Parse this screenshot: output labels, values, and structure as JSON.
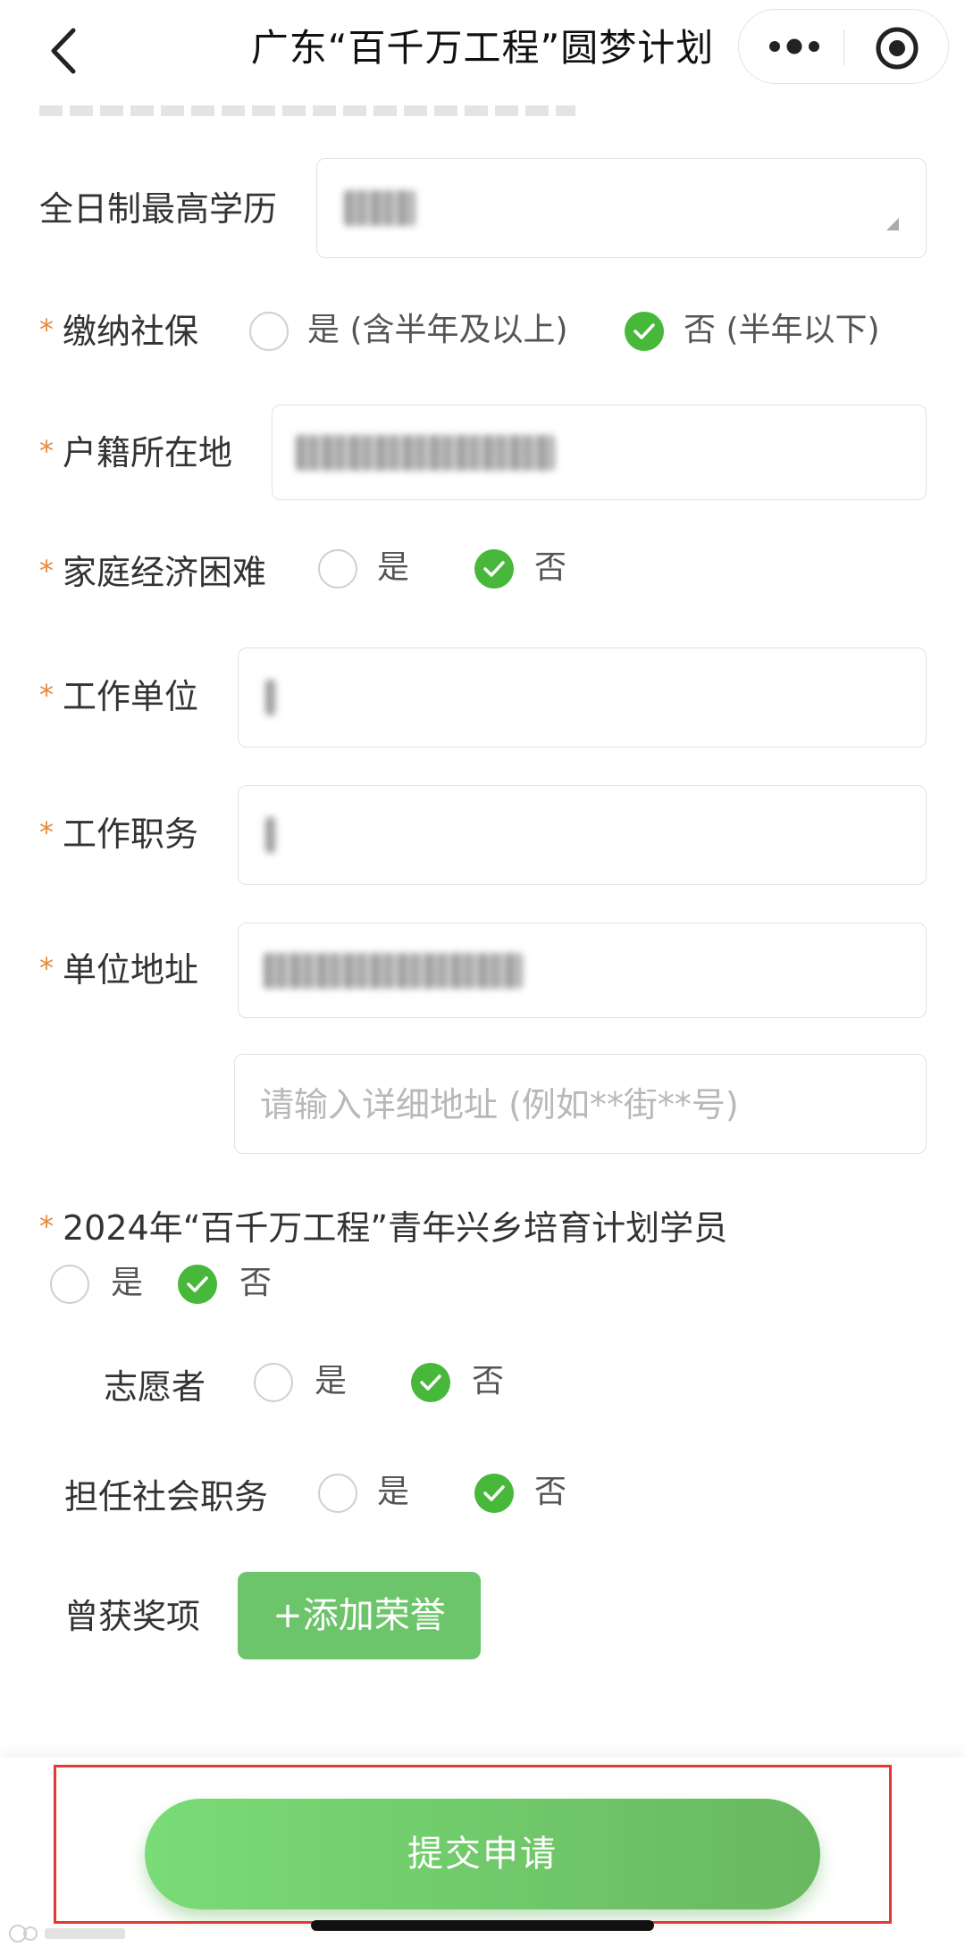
{
  "header": {
    "title": "广东“百千万工程”圆梦计划"
  },
  "form": {
    "education": {
      "label": "全日制最高学历"
    },
    "social_insurance": {
      "label": "缴纳社保",
      "opt_yes": "是 (含半年及以上)",
      "opt_no": "否 (半年以下)",
      "selected": "no"
    },
    "household": {
      "label": "户籍所在地"
    },
    "hardship": {
      "label": "家庭经济困难",
      "opt_yes": "是",
      "opt_no": "否",
      "selected": "no"
    },
    "employer": {
      "label": "工作单位"
    },
    "position": {
      "label": "工作职务"
    },
    "address": {
      "label": "单位地址",
      "detail_placeholder": "请输入详细地址 (例如**街**号)"
    },
    "trainee": {
      "label": "2024年“百千万工程”青年兴乡培育计划学员",
      "opt_yes": "是",
      "opt_no": "否",
      "selected": "no"
    },
    "volunteer": {
      "label": "志愿者",
      "opt_yes": "是",
      "opt_no": "否",
      "selected": "no"
    },
    "social_role": {
      "label": "担任社会职务",
      "opt_yes": "是",
      "opt_no": "否",
      "selected": "no"
    },
    "awards": {
      "label": "曾获奖项",
      "add_button": "+添加荣誉"
    }
  },
  "footer": {
    "submit_label": "提交申请"
  },
  "colors": {
    "accent": "#47b83a",
    "required_star": "#e68a3a",
    "highlight_box": "#e53935"
  }
}
